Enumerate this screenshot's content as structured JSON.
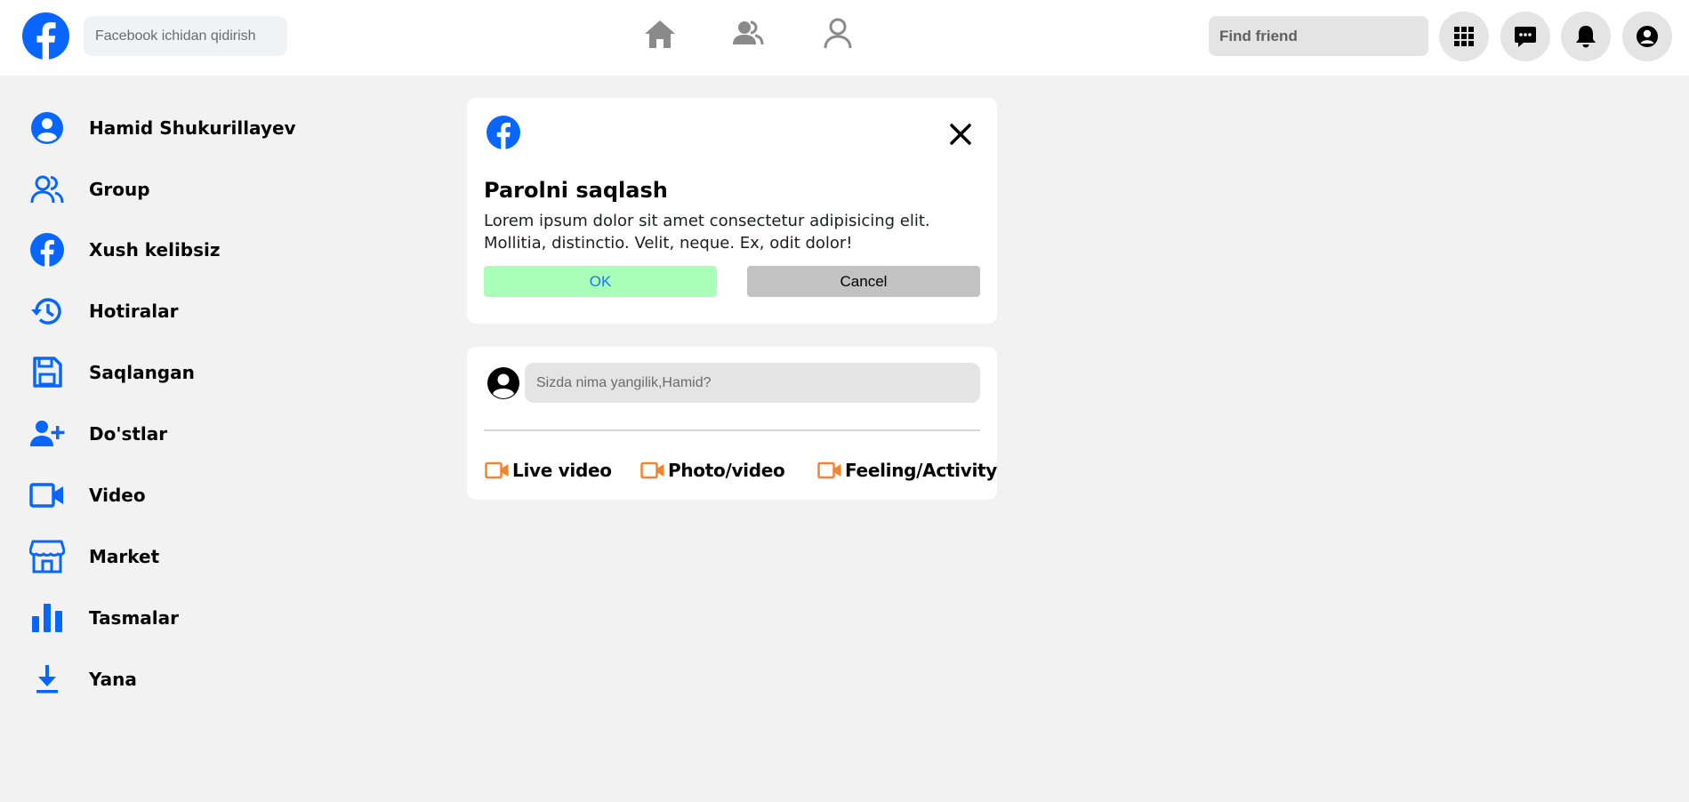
{
  "colors": {
    "brand": "#0866ff",
    "accent_orange": "#f5822e",
    "ok_bg": "#aaffb8",
    "cancel_bg": "#c2c2c2",
    "page_bg": "#f2f2f2"
  },
  "header": {
    "logo_icon": "facebook-logo-icon",
    "search_placeholder": "Facebook ichidan qidirish",
    "nav": [
      {
        "icon": "home-icon"
      },
      {
        "icon": "friends-icon"
      },
      {
        "icon": "profile-icon"
      }
    ],
    "find_friend_placeholder": "Find friend",
    "right_buttons": [
      {
        "icon": "grid-menu-icon"
      },
      {
        "icon": "messenger-icon"
      },
      {
        "icon": "bell-icon"
      },
      {
        "icon": "account-icon"
      }
    ]
  },
  "sidebar": {
    "items": [
      {
        "label": "Hamid Shukurillayev",
        "icon": "user-circle-icon"
      },
      {
        "label": "Group",
        "icon": "group-icon"
      },
      {
        "label": "Xush kelibsiz",
        "icon": "facebook-icon"
      },
      {
        "label": "Hotiralar",
        "icon": "history-icon"
      },
      {
        "label": "Saqlangan",
        "icon": "save-icon"
      },
      {
        "label": "Do'stlar",
        "icon": "add-friend-icon"
      },
      {
        "label": "Video",
        "icon": "video-icon"
      },
      {
        "label": "Market",
        "icon": "store-icon"
      },
      {
        "label": "Tasmalar",
        "icon": "bar-chart-icon"
      },
      {
        "label": "Yana",
        "icon": "download-icon"
      }
    ]
  },
  "dialog": {
    "title": "Parolni saqlash",
    "text": "Lorem ipsum dolor sit amet consectetur adipisicing elit. Mollitia, distinctio. Velit, neque. Ex, odit dolor!",
    "ok_label": "OK",
    "cancel_label": "Cancel"
  },
  "composer": {
    "placeholder": "Sizda nima yangilik,Hamid?",
    "actions": [
      {
        "label": "Live video",
        "icon": "video-camera-icon"
      },
      {
        "label": "Photo/video",
        "icon": "video-camera-icon"
      },
      {
        "label": "Feeling/Activity",
        "icon": "video-camera-icon"
      }
    ]
  }
}
